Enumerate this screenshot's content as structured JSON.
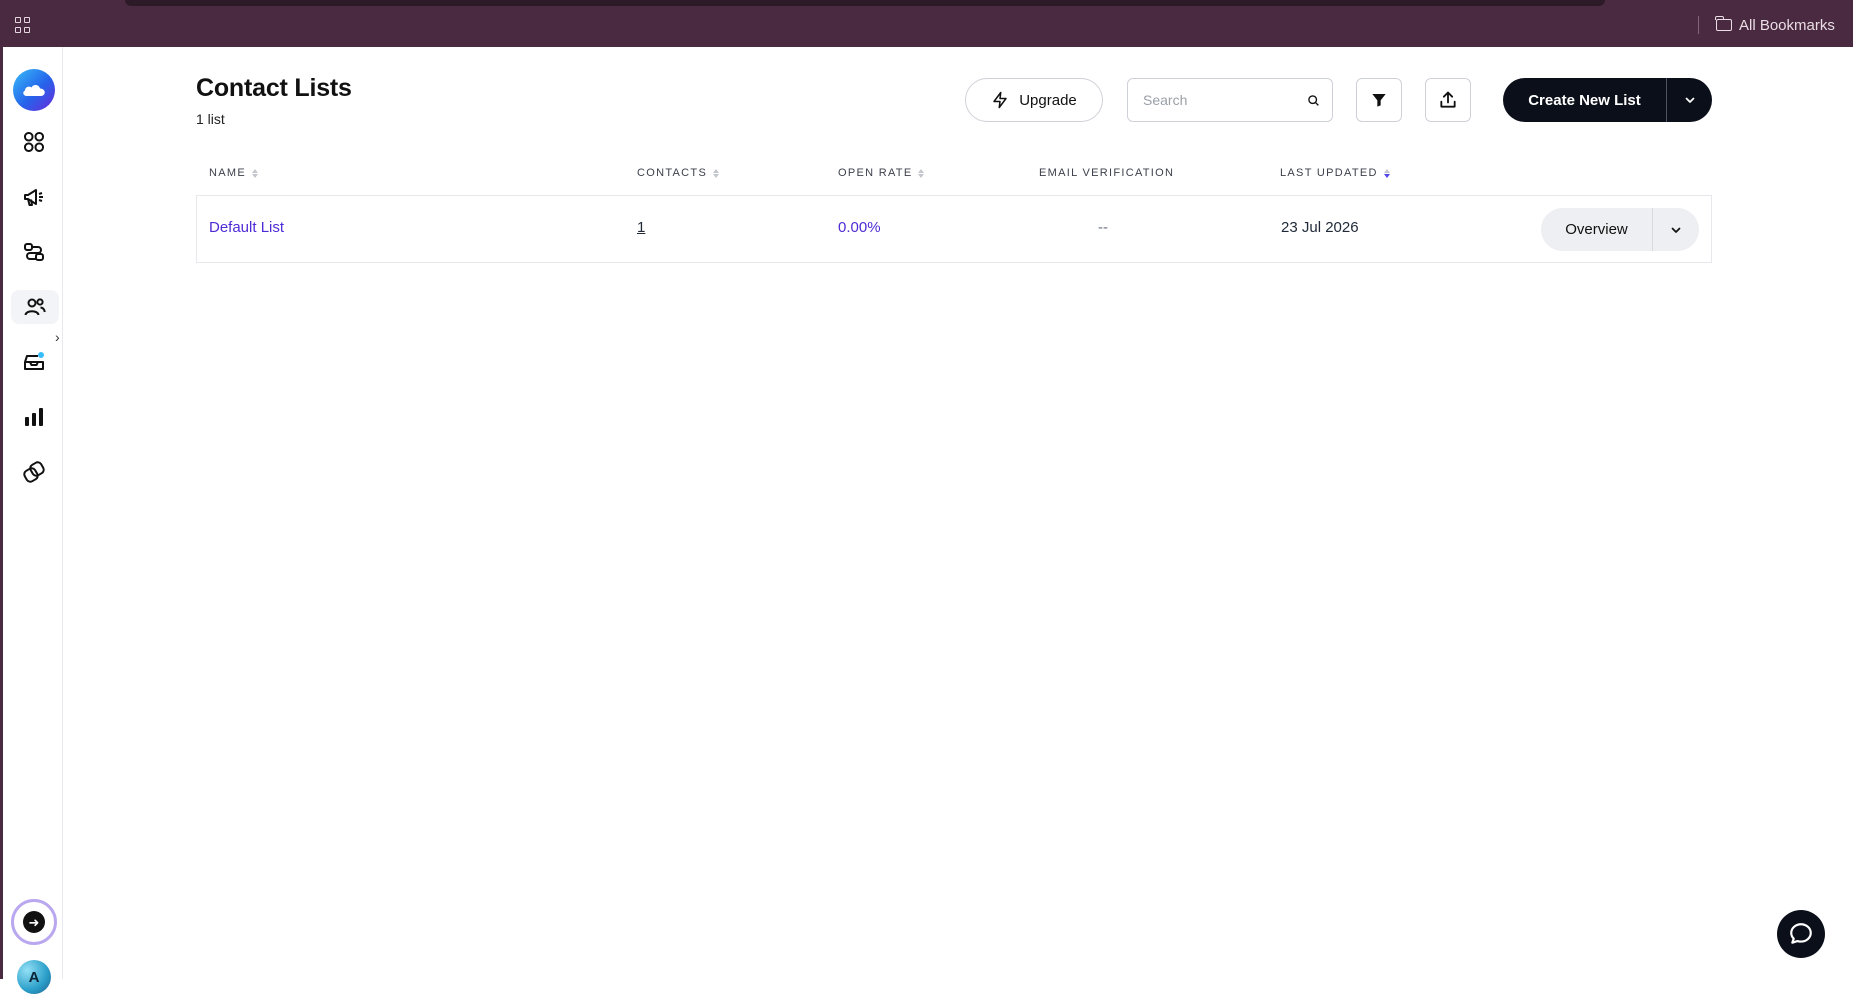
{
  "browser": {
    "bookmarks_label": "All Bookmarks"
  },
  "sidebar": {
    "items": [
      {
        "icon": "dashboard-icon"
      },
      {
        "icon": "megaphone-icon"
      },
      {
        "icon": "automation-icon"
      },
      {
        "icon": "contacts-icon",
        "active": true
      },
      {
        "icon": "inbox-icon",
        "badge": true
      },
      {
        "icon": "analytics-icon"
      },
      {
        "icon": "integrations-icon"
      }
    ],
    "avatar_initial": "A"
  },
  "header": {
    "title": "Contact Lists",
    "subtitle": "1 list",
    "upgrade_label": "Upgrade",
    "search_placeholder": "Search",
    "create_label": "Create New List"
  },
  "table": {
    "columns": [
      "NAME",
      "CONTACTS",
      "OPEN RATE",
      "EMAIL VERIFICATION",
      "LAST UPDATED"
    ],
    "rows": [
      {
        "name": "Default List",
        "contacts": "1",
        "open_rate": "0.00%",
        "email_verification": "--",
        "last_updated": "23 Jul 2026",
        "action_label": "Overview"
      }
    ]
  },
  "colors": {
    "browser_bar": "#4a2a40",
    "primary_button": "#0b0f19",
    "link": "#4f2bd6"
  }
}
